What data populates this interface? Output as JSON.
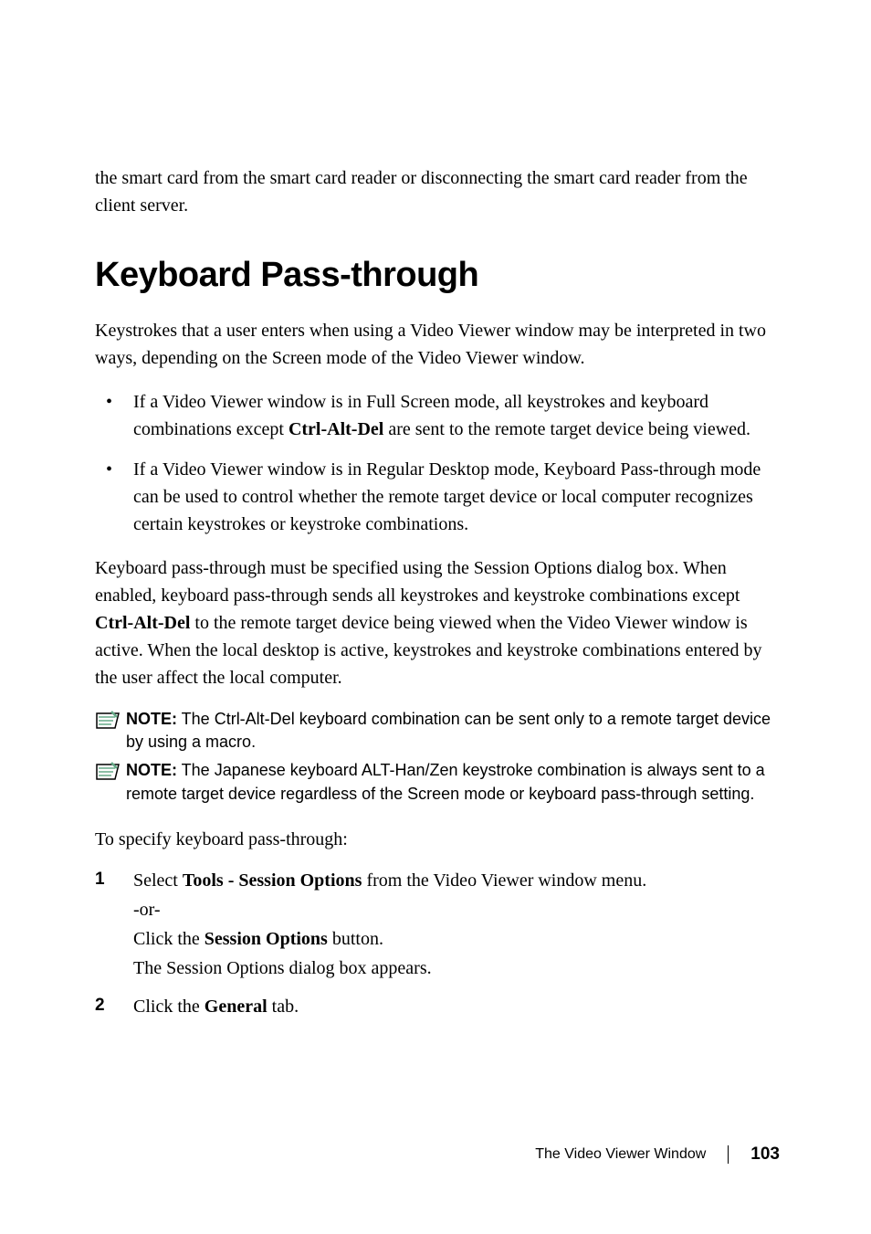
{
  "intro": "the smart card from the smart card reader or disconnecting the smart card reader from the client server.",
  "heading": "Keyboard Pass-through",
  "para1": "Keystrokes that a user enters when using a Video Viewer window may be interpreted in two ways, depending on the Screen mode of the Video Viewer window.",
  "bullets": [
    {
      "pre": "If a Video Viewer window is in Full Screen mode, all keystrokes and keyboard combinations except ",
      "bold": "Ctrl-Alt-Del",
      "post": " are sent to the remote target device being viewed."
    },
    {
      "pre": "If a Video Viewer window is in Regular Desktop mode, Keyboard Pass-through mode can be used to control whether the remote target device or local computer recognizes certain keystrokes or keystroke combinations.",
      "bold": "",
      "post": ""
    }
  ],
  "para2_pre": "Keyboard pass-through must be specified using the Session Options dialog box. When enabled, keyboard pass-through sends all keystrokes and keystroke combinations except ",
  "para2_bold": "Ctrl-Alt-Del",
  "para2_post": " to the remote target device being viewed when the Video Viewer window is active. When the local desktop is active, keystrokes and keystroke combinations entered by the user affect the local computer.",
  "notes": [
    {
      "label": "NOTE:",
      "text": " The Ctrl-Alt-Del keyboard combination can be sent only to a remote target device by using a macro."
    },
    {
      "label": "NOTE:",
      "text": " The Japanese keyboard ALT-Han/Zen keystroke combination is always sent to a remote target device regardless of the Screen mode or keyboard pass-through setting."
    }
  ],
  "specify_text": "To specify keyboard pass-through:",
  "steps": [
    {
      "num": "1",
      "pre": "Select ",
      "bold1": "Tools - Session Options",
      "mid1": " from the Video Viewer window menu.",
      "line2": "-or-",
      "line3_pre": "Click the ",
      "line3_bold": "Session Options",
      "line3_post": " button.",
      "line4": "The Session Options dialog box appears."
    },
    {
      "num": "2",
      "pre": "Click the ",
      "bold1": "General",
      "mid1": " tab."
    }
  ],
  "footer": {
    "title": "The Video Viewer Window",
    "page": "103"
  }
}
